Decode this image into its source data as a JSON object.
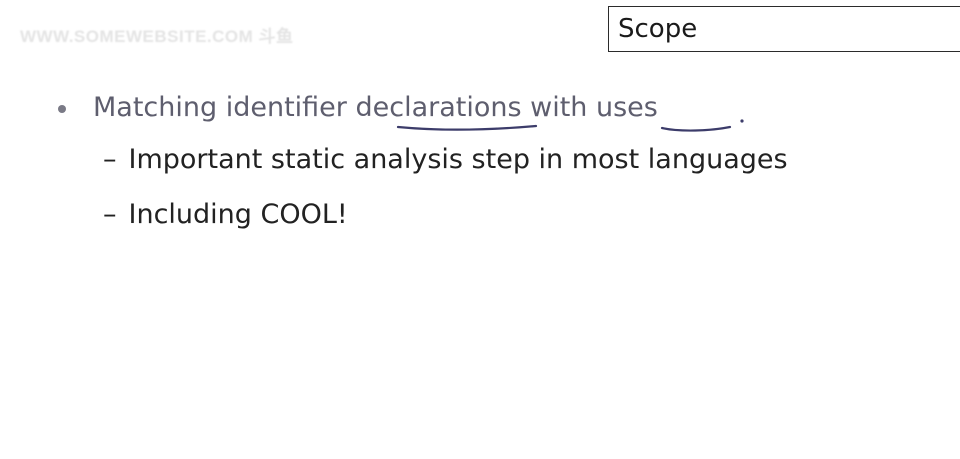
{
  "watermark": "WWW.SOMEWEBSITE.COM 斗鱼",
  "slide": {
    "title": "Scope",
    "bullet": "Matching identifier declarations with uses",
    "sub_bullets": [
      "Important static analysis step in most languages",
      "Including COOL!"
    ],
    "dash": "–",
    "text_color": "#222222",
    "bullet_color": "#5e5e6e",
    "annotation_color": "#3c3c6a"
  }
}
